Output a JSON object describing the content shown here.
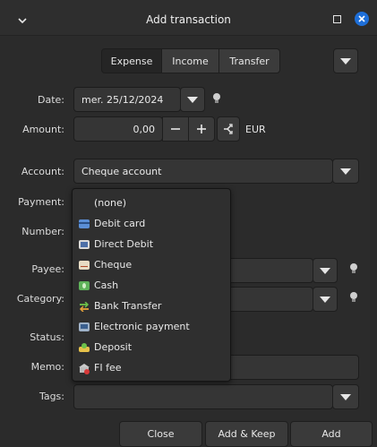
{
  "window": {
    "title": "Add transaction"
  },
  "type_tabs": [
    "Expense",
    "Income",
    "Transfer"
  ],
  "labels": {
    "date": "Date:",
    "amount": "Amount:",
    "account": "Account:",
    "payment": "Payment:",
    "number": "Number:",
    "payee": "Payee:",
    "category": "Category:",
    "status": "Status:",
    "memo": "Memo:",
    "tags": "Tags:"
  },
  "date": {
    "value": "mer. 25/12/2024"
  },
  "amount": {
    "value": "0,00",
    "currency": "EUR"
  },
  "account": {
    "value": "Cheque account"
  },
  "payment_menu": {
    "items": [
      {
        "label": "(none)",
        "icon": "none"
      },
      {
        "label": "Debit card",
        "icon": "card-icon"
      },
      {
        "label": "Direct Debit",
        "icon": "direct-debit-icon"
      },
      {
        "label": "Cheque",
        "icon": "cheque-icon"
      },
      {
        "label": "Cash",
        "icon": "cash-icon"
      },
      {
        "label": "Bank Transfer",
        "icon": "transfer-icon"
      },
      {
        "label": "Electronic payment",
        "icon": "electronic-payment-icon"
      },
      {
        "label": "Deposit",
        "icon": "deposit-icon"
      },
      {
        "label": "FI fee",
        "icon": "fee-icon"
      }
    ]
  },
  "buttons": {
    "close": "Close",
    "add_keep": "Add & Keep",
    "add": "Add"
  },
  "colors": {
    "close_button": "#1e6fd9",
    "window_bg": "#2b2b2b"
  }
}
